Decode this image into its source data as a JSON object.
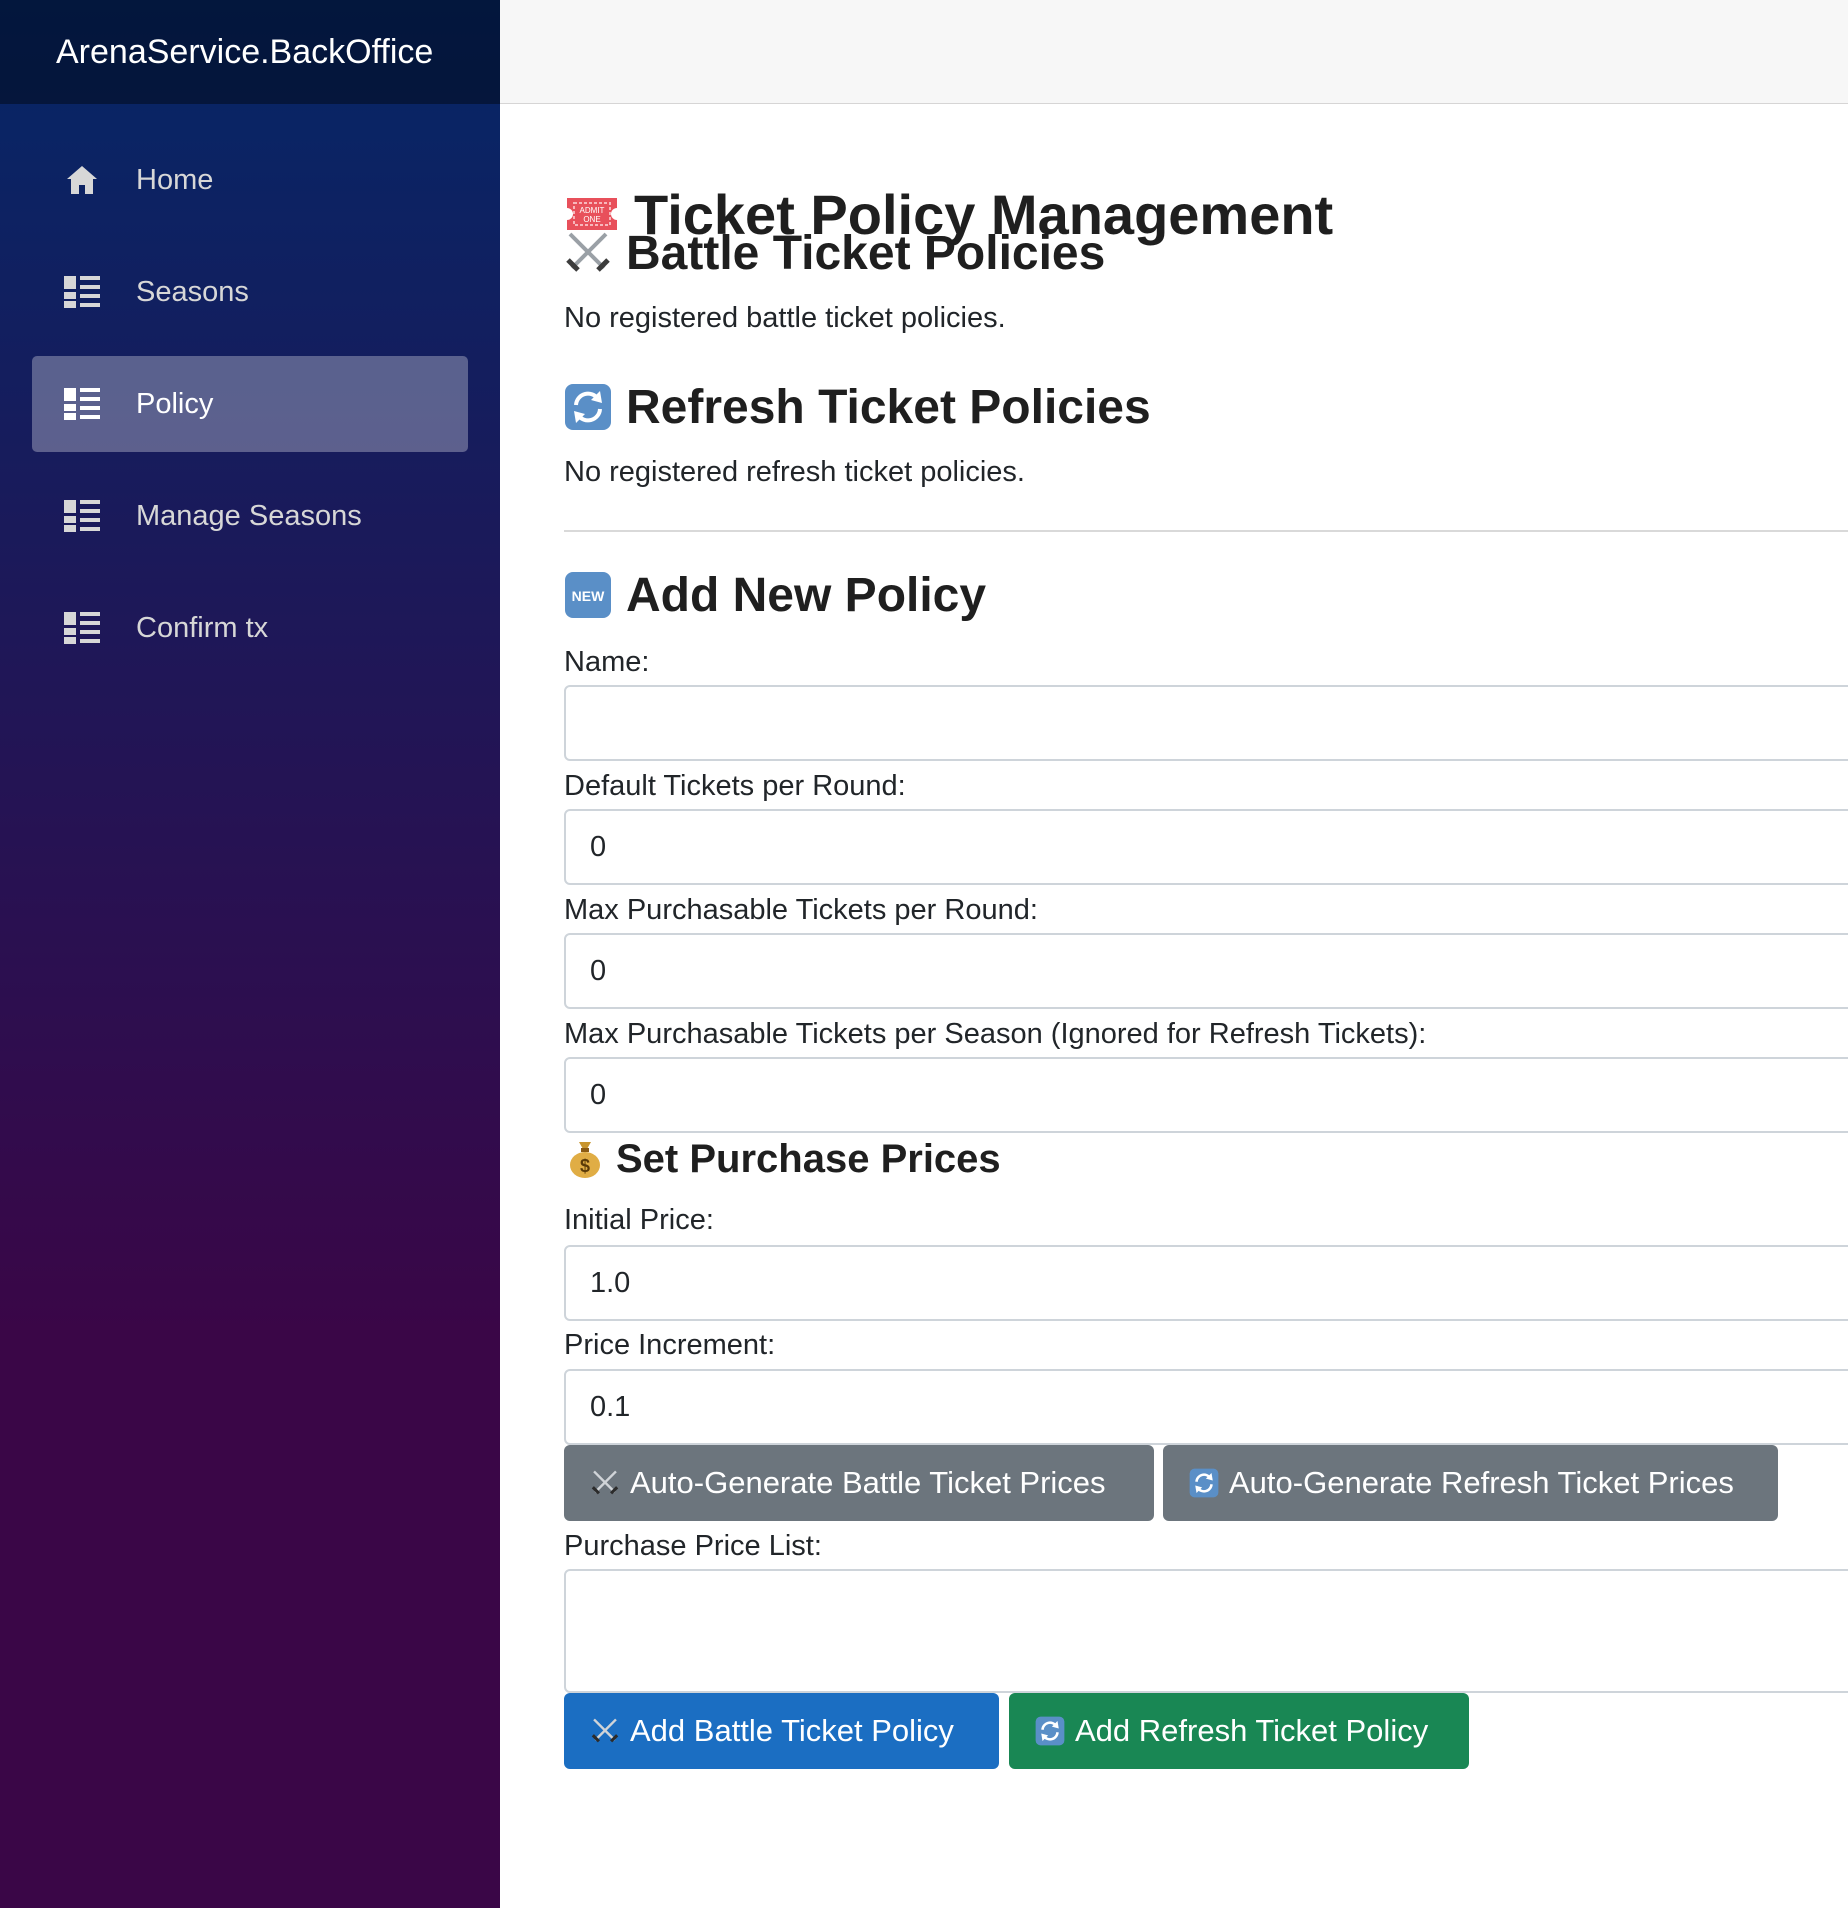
{
  "app": {
    "brand": "ArenaService.BackOffice"
  },
  "sidebar": {
    "items": [
      {
        "label": "Home",
        "icon": "home-icon",
        "active": false
      },
      {
        "label": "Seasons",
        "icon": "list-icon",
        "active": false
      },
      {
        "label": "Policy",
        "icon": "list-icon",
        "active": true
      },
      {
        "label": "Manage Seasons",
        "icon": "list-icon",
        "active": false
      },
      {
        "label": "Confirm tx",
        "icon": "list-icon",
        "active": false
      }
    ]
  },
  "page": {
    "title": "Ticket Policy Management",
    "battle_section": {
      "title": "Battle Ticket Policies",
      "empty_text": "No registered battle ticket policies."
    },
    "refresh_section": {
      "title": "Refresh Ticket Policies",
      "empty_text": "No registered refresh ticket policies."
    },
    "add_section": {
      "title": "Add New Policy"
    }
  },
  "form": {
    "name": {
      "label": "Name:",
      "value": ""
    },
    "default_tickets": {
      "label": "Default Tickets per Round:",
      "value": "0"
    },
    "max_round": {
      "label": "Max Purchasable Tickets per Round:",
      "value": "0"
    },
    "max_season": {
      "label": "Max Purchasable Tickets per Season (Ignored for Refresh Tickets):",
      "value": "0"
    },
    "prices_heading": "Set Purchase Prices",
    "initial_price": {
      "label": "Initial Price:",
      "value": "1.0"
    },
    "price_increment": {
      "label": "Price Increment:",
      "value": "0.1"
    },
    "auto_battle_label": "Auto-Generate Battle Ticket Prices",
    "auto_refresh_label": "Auto-Generate Refresh Ticket Prices",
    "price_list": {
      "label": "Purchase Price List:",
      "value": ""
    },
    "add_battle_label": "Add Battle Ticket Policy",
    "add_refresh_label": "Add Refresh Ticket Policy"
  },
  "colors": {
    "sidebar_top": "#052767",
    "sidebar_bottom": "#3a0647",
    "primary": "#1b6ec2",
    "success": "#198754",
    "secondary": "#6c757d"
  }
}
